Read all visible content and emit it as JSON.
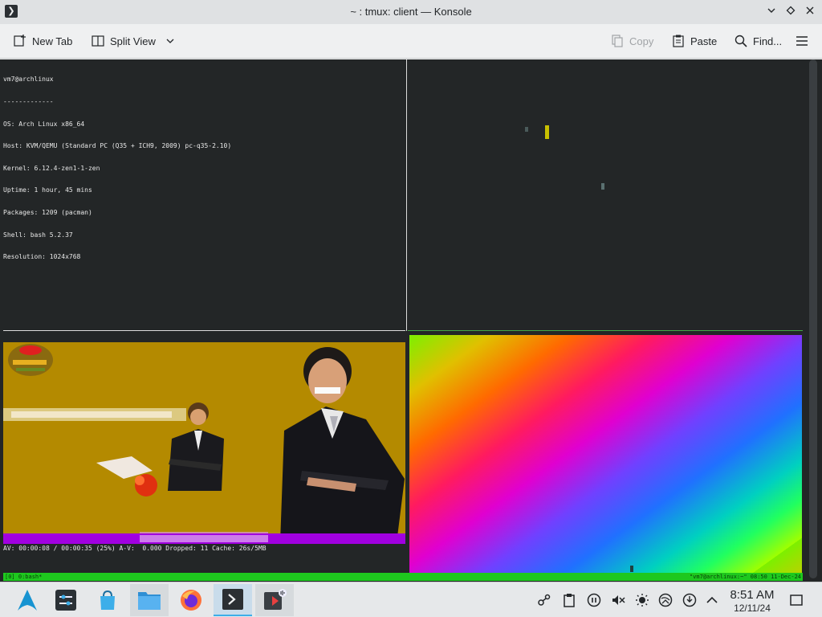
{
  "window": {
    "title": "~ : tmux: client — Konsole",
    "app_icon": "terminal-icon"
  },
  "toolbar": {
    "new_tab": "New Tab",
    "split_view": "Split View",
    "copy": "Copy",
    "paste": "Paste",
    "find": "Find..."
  },
  "terminal": {
    "sysinfo_lines": [
      "vm7@archlinux",
      "-------------",
      "OS: Arch Linux x86_64",
      "Host: KVM/QEMU (Standard PC (Q35 + ICH9, 2009) pc-q35-2.10)",
      "Kernel: 6.12.4-zen1-1-zen",
      "Uptime: 1 hour, 45 mins",
      "Packages: 1209 (pacman)",
      "Shell: bash 5.2.37",
      "Resolution: 1024x768"
    ],
    "mpv_status": "AV: 00:00:08 / 00:00:35 (25%) A-V:  0.000 Dropped: 11 Cache: 26s/5MB",
    "tmux_left": "[0] 0:bash*",
    "tmux_right": "\"vm7@archlinux:~\" 08:50 11-Dec-24"
  },
  "taskbar": {
    "apps": [
      "arch-linux-launcher-icon",
      "system-settings-icon",
      "discover-store-icon",
      "file-manager-icon",
      "firefox-icon",
      "konsole-icon",
      "media-player-icon"
    ],
    "clock_time": "8:51 AM",
    "clock_date": "12/11/24"
  },
  "colors": {
    "terminal_bg": "#232627",
    "tmux_status": "#1ec81e",
    "accent": "#3daee9"
  }
}
